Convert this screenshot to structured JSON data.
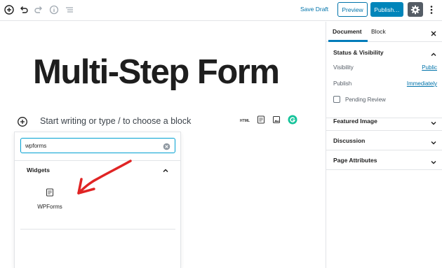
{
  "toolbar": {
    "icons": [
      "add-block-icon",
      "undo-icon",
      "redo-icon",
      "info-icon",
      "list-view-icon"
    ],
    "save_draft_label": "Save Draft",
    "preview_label": "Preview",
    "publish_label": "Publish…",
    "settings_icon": "gear-icon",
    "more_icon": "more-vertical-icon"
  },
  "editor": {
    "title": "Multi-Step Form",
    "placeholder": "Start writing or type / to choose a block",
    "quick_blocks": [
      "html-icon",
      "wpforms-icon",
      "image-icon",
      "grammarly-icon"
    ],
    "html_label": "HTML"
  },
  "inserter": {
    "search_value": "wpforms",
    "panel_title": "Widgets",
    "results": [
      {
        "label": "WPForms",
        "icon": "wpforms-icon"
      }
    ],
    "annotation_color": "#e02424"
  },
  "sidebar": {
    "tabs": [
      {
        "label": "Document",
        "active": true
      },
      {
        "label": "Block",
        "active": false
      }
    ],
    "status": {
      "title": "Status & Visibility",
      "visibility_label": "Visibility",
      "visibility_value": "Public",
      "publish_label": "Publish",
      "publish_value": "Immediately",
      "pending_review_label": "Pending Review",
      "pending_review_checked": false
    },
    "sections": [
      "Featured Image",
      "Discussion",
      "Page Attributes"
    ]
  },
  "colors": {
    "accent": "#0085ba",
    "link": "#0073aa",
    "focus": "#00a0d2",
    "settings_bg": "#555d66",
    "grammarly": "#15c39a"
  }
}
